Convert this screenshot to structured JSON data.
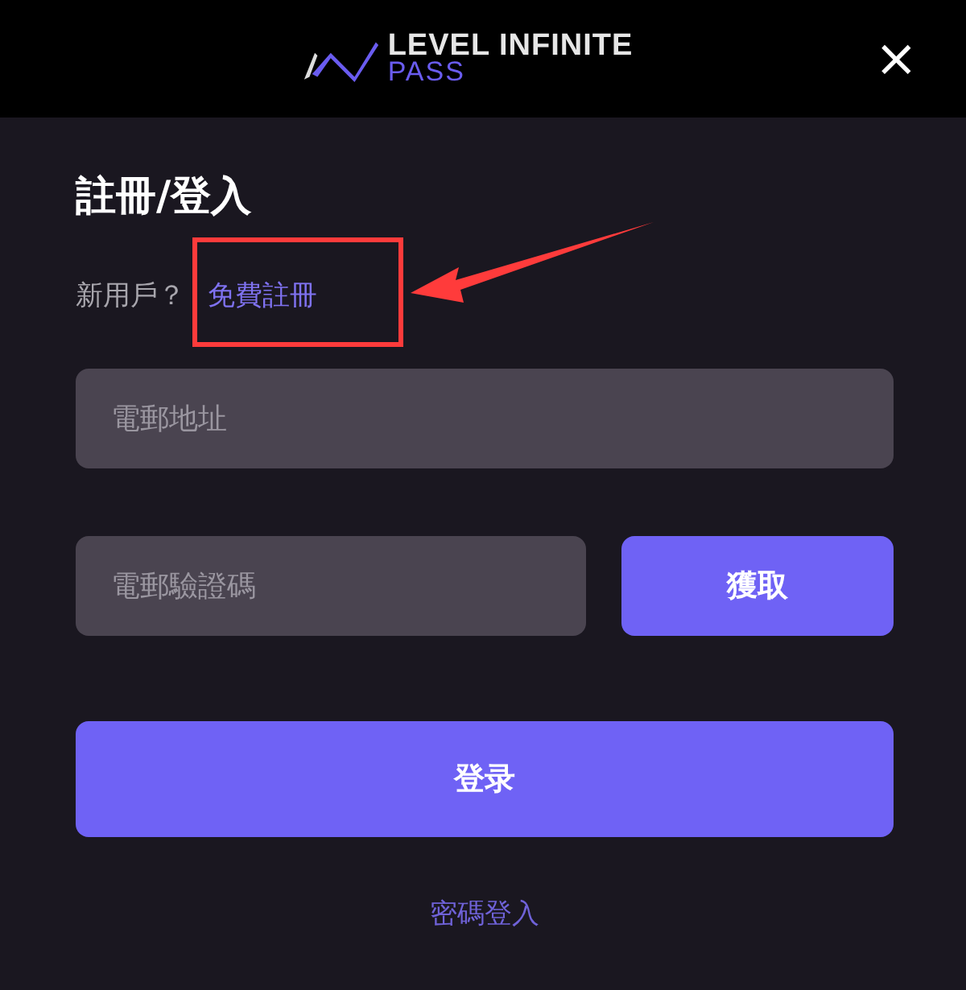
{
  "header": {
    "logo_top": "LEVEL INFINITE",
    "logo_bottom": "PASS",
    "close": "×"
  },
  "title": "註冊/登入",
  "signup": {
    "prompt": "新用戶？",
    "link": "免費註冊",
    "annotated": true
  },
  "email_field": {
    "placeholder": "電郵地址"
  },
  "code_field": {
    "placeholder": "電郵驗證碼"
  },
  "get_code_button": "獲取",
  "login_button": "登录",
  "password_login_link": "密碼登入"
}
